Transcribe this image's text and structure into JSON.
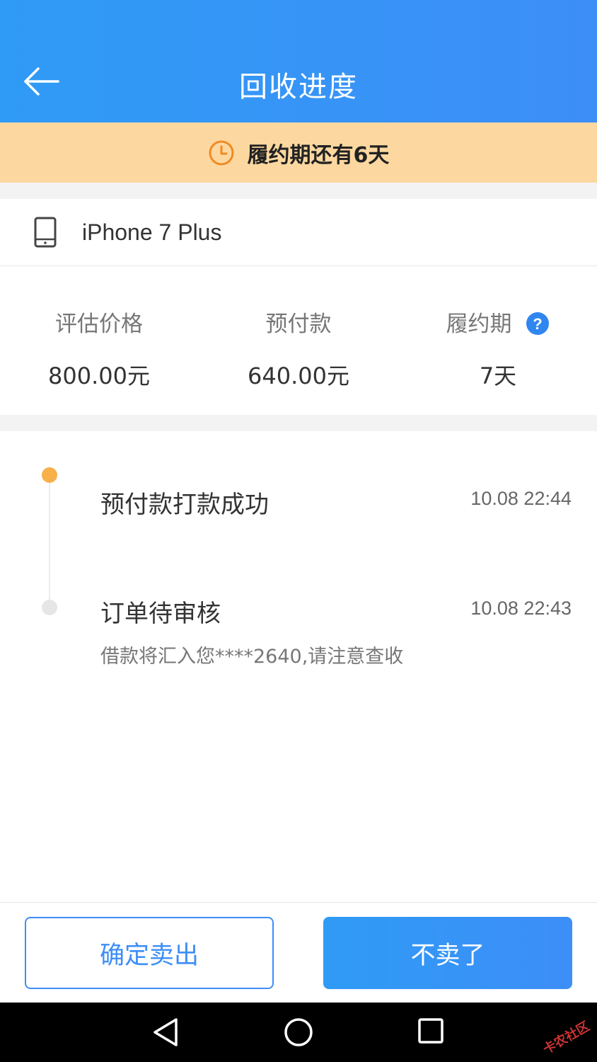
{
  "header": {
    "title": "回收进度",
    "background": "#3d8ef7"
  },
  "notice": {
    "text": "履约期还有6天",
    "background": "#fcd8a0",
    "icon": "clock-icon",
    "icon_color": "#f08a24"
  },
  "device": {
    "name": "iPhone 7 Plus",
    "icon": "phone-icon"
  },
  "stats": [
    {
      "label": "评估价格",
      "value": "800.00元"
    },
    {
      "label": "预付款",
      "value": "640.00元"
    },
    {
      "label": "履约期",
      "value": "7天",
      "icon": "help-icon"
    }
  ],
  "timeline": [
    {
      "title": "预付款打款成功",
      "time": "10.08 22:44",
      "status": "active",
      "color": "#f7b04a"
    },
    {
      "title": "订单待审核",
      "time": "10.08 22:43",
      "status": "inactive",
      "note": "借款将汇入您****2640,请注意查收"
    }
  ],
  "footer": {
    "confirm_label": "确定卖出",
    "cancel_label": "不卖了"
  },
  "navbar": {
    "buttons": [
      "back-icon",
      "home-icon",
      "recent-apps-icon"
    ]
  },
  "watermark": "卡农社区"
}
